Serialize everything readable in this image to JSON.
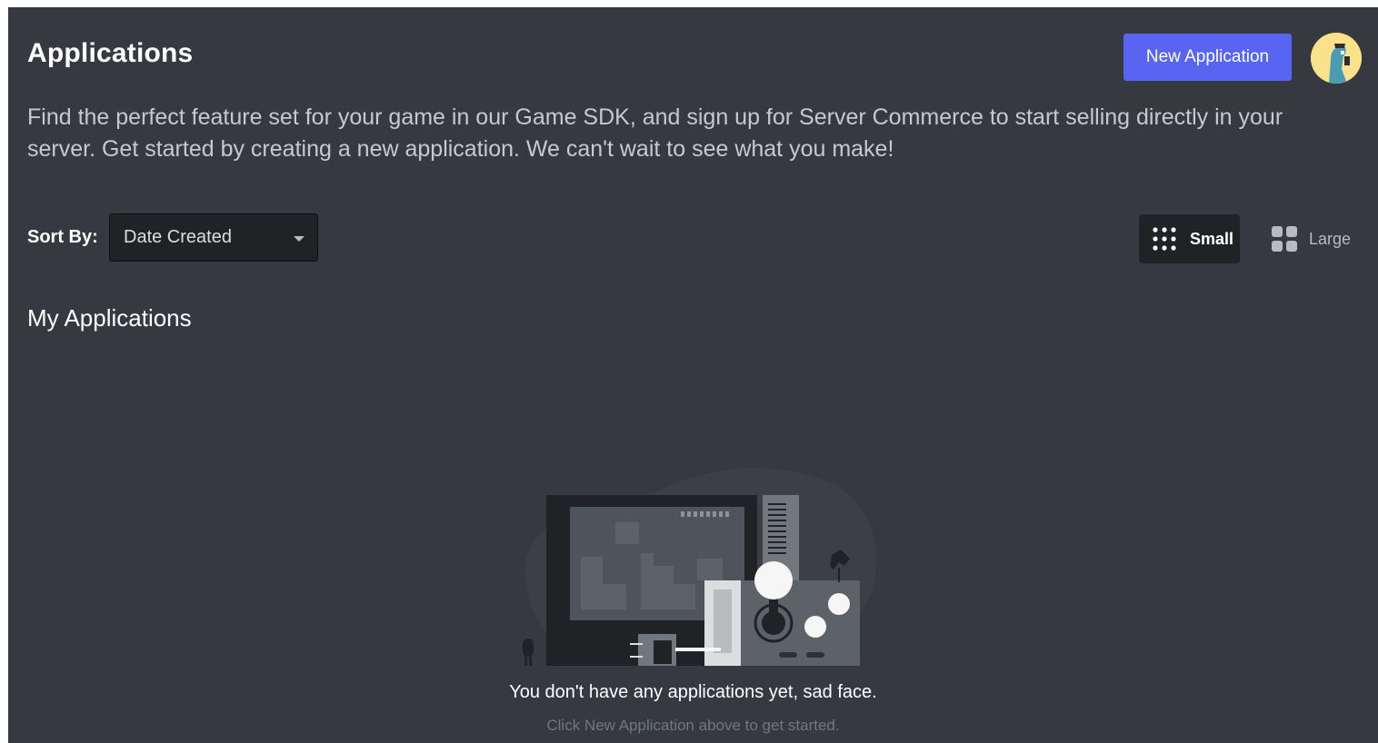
{
  "header": {
    "title": "Applications",
    "new_app_label": "New Application",
    "description": "Find the perfect feature set for your game in our Game SDK, and sign up for Server Commerce to start selling directly in your server. Get started by creating a new application. We can't wait to see what you make!"
  },
  "sort": {
    "label": "Sort By:",
    "selected": "Date Created"
  },
  "view_toggle": {
    "small_label": "Small",
    "large_label": "Large",
    "active": "Small"
  },
  "section_title": "My Applications",
  "empty_state": {
    "message": "You don't have any applications yet, sad face.",
    "hint": "Click New Application above to get started."
  },
  "colors": {
    "background": "#36393f",
    "accent": "#5865f2",
    "avatar_bg": "#fbe18a"
  },
  "icons": [
    "avatar",
    "caret-down-icon",
    "small-grid-icon",
    "large-grid-icon",
    "empty-state-illustration"
  ]
}
